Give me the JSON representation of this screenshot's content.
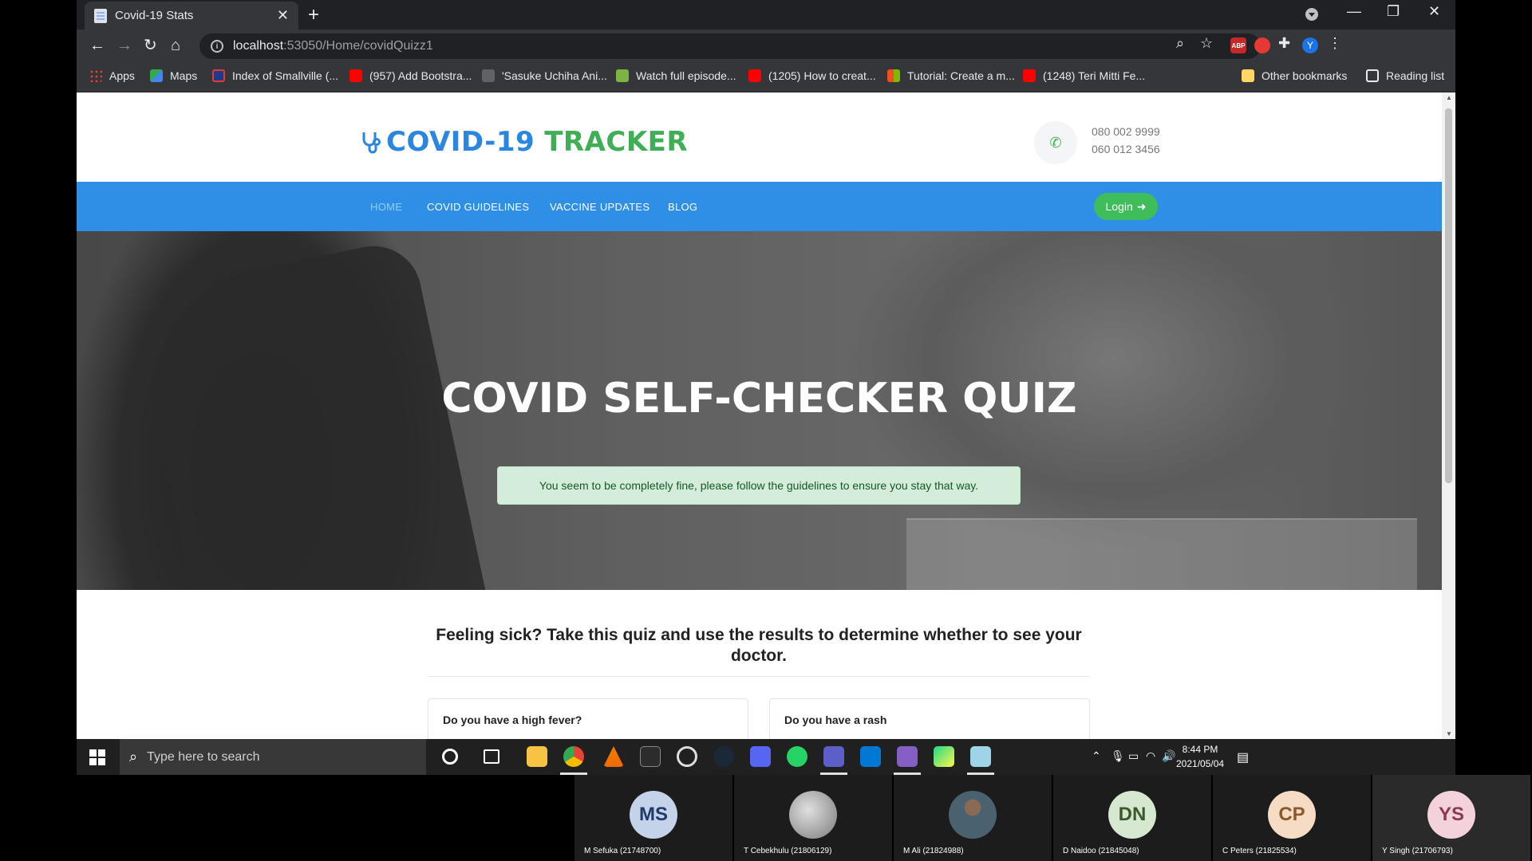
{
  "browser": {
    "tab_title": "Covid-19 Stats",
    "url_host": "localhost",
    "url_rest": ":53050/Home/covidQuizz1",
    "profile_initial": "Y",
    "ext_abp": "ABP",
    "bookmarks": [
      "Apps",
      "Maps",
      "Index of Smallville (...",
      "(957) Add Bootstra...",
      "'Sasuke Uchiha Ani...",
      "Watch full episode...",
      "(1205) How to creat...",
      "Tutorial: Create a m...",
      "(1248) Teri Mitti Fe..."
    ],
    "other_bookmarks": "Other bookmarks",
    "reading_list": "Reading list"
  },
  "site": {
    "logo_part1": "COVID-19",
    "logo_part2": "TRACKER",
    "phone1": "080 002 9999",
    "phone2": "060 012 3456",
    "nav": [
      "HOME",
      "COVID GUIDELINES",
      "VACCINE UPDATES",
      "BLOG"
    ],
    "login_label": "Login"
  },
  "hero": {
    "title": "COVID SELF-CHECKER QUIZ",
    "result_message": "You seem to be completely fine, please follow the guidelines to ensure you stay that way."
  },
  "quiz": {
    "intro_line1": "Feeling sick? Take this quiz and use the results to determine whether to see your",
    "intro_line2": "doctor.",
    "questions": [
      "Do you have a high fever?",
      "Do you have a rash"
    ]
  },
  "taskbar": {
    "search_placeholder": "Type here to search",
    "time": "8:44 PM",
    "date": "2021/05/04"
  },
  "participants": [
    {
      "initials": "MS",
      "name": "M Sefuka (21748700)",
      "color": "#c5d3ea",
      "text_color": "#1f3a6b"
    },
    {
      "initials": "",
      "name": "T Cebekhulu (21806129)",
      "color": "#9e9e9e",
      "text_color": "#fff"
    },
    {
      "initials": "",
      "name": "M Ali (21824988)",
      "color": "#4a6170",
      "text_color": "#fff"
    },
    {
      "initials": "DN",
      "name": "D Naidoo (21845048)",
      "color": "#d6e8cf",
      "text_color": "#3a5a2e"
    },
    {
      "initials": "CP",
      "name": "C Peters (21825534)",
      "color": "#f6dcc5",
      "text_color": "#8a5a2a"
    },
    {
      "initials": "YS",
      "name": "Y Singh (21706793)",
      "color": "#f4d2dc",
      "text_color": "#8a3a52"
    }
  ]
}
